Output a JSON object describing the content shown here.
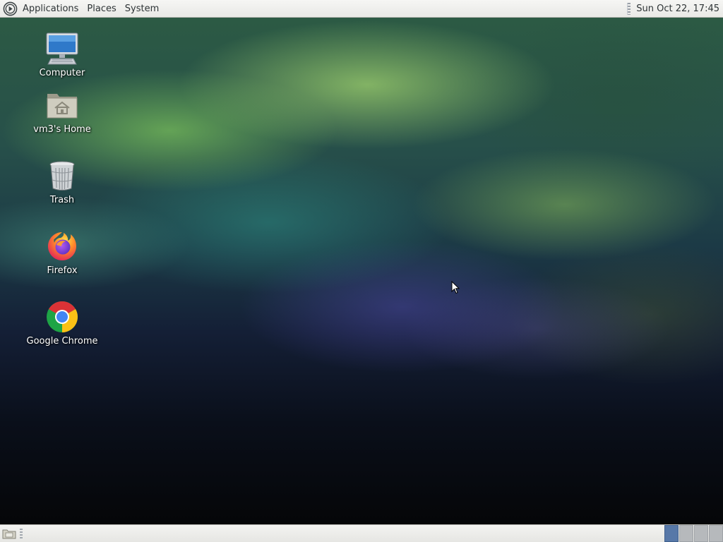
{
  "top_panel": {
    "menus": [
      {
        "label": "Applications"
      },
      {
        "label": "Places"
      },
      {
        "label": "System"
      }
    ],
    "clock": "Sun Oct 22, 17:45"
  },
  "desktop": {
    "icons": [
      {
        "label": "Computer",
        "icon": "computer-icon"
      },
      {
        "label": "vm3's Home",
        "icon": "home-folder-icon"
      },
      {
        "label": "Trash",
        "icon": "trash-icon"
      },
      {
        "label": "Firefox",
        "icon": "firefox-icon"
      },
      {
        "label": "Google Chrome",
        "icon": "chrome-icon"
      }
    ]
  },
  "bottom_panel": {
    "workspaces": [
      {
        "active": true
      },
      {
        "active": false
      },
      {
        "active": false
      },
      {
        "active": false
      }
    ]
  },
  "colors": {
    "panel_bg": "#ececea",
    "active_workspace": "#5778a8",
    "label_text": "#ffffff"
  }
}
